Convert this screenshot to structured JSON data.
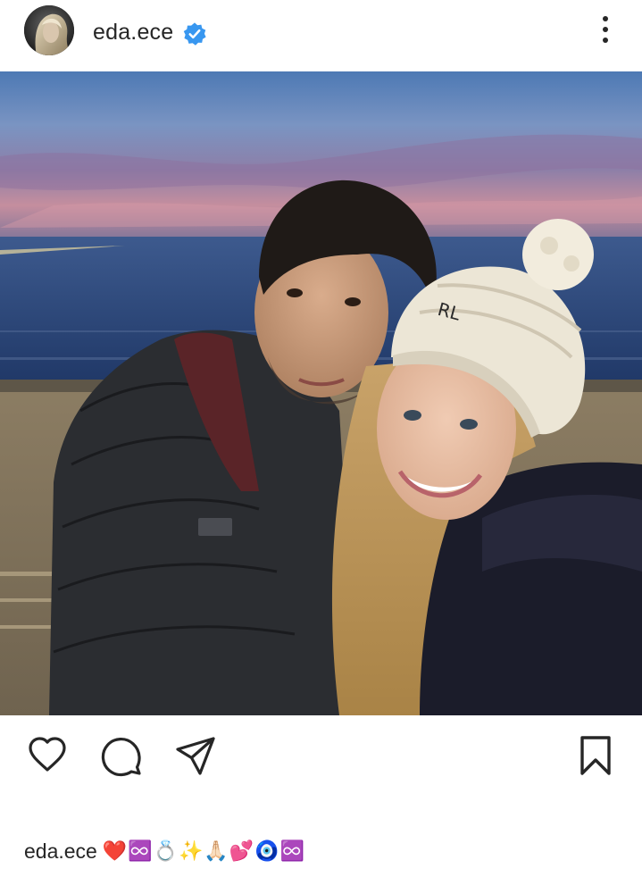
{
  "post": {
    "username": "eda.ece",
    "verified": true,
    "caption_username": "eda.ece",
    "caption_text": "❤️♾️💍✨🙏🏻💕🧿♾️"
  },
  "icons": {
    "more": "more-vertical-icon",
    "like": "heart-icon",
    "comment": "comment-bubble-icon",
    "share": "paper-plane-icon",
    "save": "bookmark-icon",
    "verified": "verified-badge-icon"
  },
  "colors": {
    "verified_badge": "#3897f0",
    "text": "#262626",
    "background": "#ffffff"
  }
}
